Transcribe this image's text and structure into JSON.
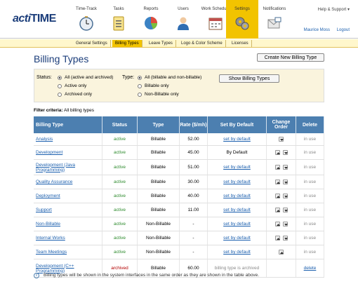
{
  "app": {
    "logo_a": "acti",
    "logo_b": "TIME",
    "help": "Help & Support ▾",
    "user": "Maurice Moss",
    "logout": "Logout"
  },
  "nav": [
    {
      "label": "Time-Track",
      "icon": "clock-icon",
      "active": false
    },
    {
      "label": "Tasks",
      "icon": "clipboard-icon",
      "active": false
    },
    {
      "label": "Reports",
      "icon": "pie-chart-icon",
      "active": false
    },
    {
      "label": "Users",
      "icon": "user-icon",
      "active": false
    },
    {
      "label": "Work Schedule",
      "icon": "calendar-icon",
      "active": false
    },
    {
      "label": "Settings",
      "icon": "gears-icon",
      "active": true
    },
    {
      "label": "Notifications",
      "icon": "notifications-icon",
      "active": false
    }
  ],
  "subnav": [
    {
      "label": "General Settings",
      "active": false
    },
    {
      "label": "Billing Types",
      "active": true
    },
    {
      "label": "Leave Types",
      "active": false
    },
    {
      "label": "Logo & Color Scheme",
      "active": false
    },
    {
      "label": "Licenses",
      "active": false
    }
  ],
  "page": {
    "title": "Billing Types",
    "create_button": "Create New Billing Type"
  },
  "filters": {
    "status_label": "Status:",
    "type_label": "Type:",
    "status_options": [
      "All (active and archived)",
      "Active only",
      "Archived only"
    ],
    "status_selected": 0,
    "type_options": [
      "All (billable and non-billable)",
      "Billable only",
      "Non-Billable only"
    ],
    "type_selected": 0,
    "show_button": "Show Billing Types",
    "criteria_label": "Filter criteria:",
    "criteria_value": "All billing types"
  },
  "table": {
    "headers": [
      "Billing Type",
      "Status",
      "Type",
      "Rate ($/mh)",
      "Set By Default",
      "Change Order",
      "Delete"
    ],
    "rows": [
      {
        "name": "Analysis",
        "status": "active",
        "type": "Billable",
        "rate": "52.00",
        "default": "set by default",
        "default_link": true,
        "order": "down",
        "delete": "in use",
        "delete_link": false
      },
      {
        "name": "Development",
        "status": "active",
        "type": "Billable",
        "rate": "45.00",
        "default": "By Default",
        "default_link": false,
        "order": "both",
        "delete": "in use",
        "delete_link": false
      },
      {
        "name": "Development (Java Programming)",
        "status": "active",
        "type": "Billable",
        "rate": "51.00",
        "default": "set by default",
        "default_link": true,
        "order": "both",
        "delete": "in use",
        "delete_link": false
      },
      {
        "name": "Quality Assurance",
        "status": "active",
        "type": "Billable",
        "rate": "30.00",
        "default": "set by default",
        "default_link": true,
        "order": "both",
        "delete": "in use",
        "delete_link": false
      },
      {
        "name": "Deployment",
        "status": "active",
        "type": "Billable",
        "rate": "40.00",
        "default": "set by default",
        "default_link": true,
        "order": "both",
        "delete": "in use",
        "delete_link": false
      },
      {
        "name": "Support",
        "status": "active",
        "type": "Billable",
        "rate": "11.00",
        "default": "set by default",
        "default_link": true,
        "order": "both",
        "delete": "in use",
        "delete_link": false
      },
      {
        "name": "Non-Billable",
        "status": "active",
        "type": "Non-Billable",
        "rate": "-",
        "default": "set by default",
        "default_link": true,
        "order": "both",
        "delete": "in use",
        "delete_link": false
      },
      {
        "name": "Internal Works",
        "status": "active",
        "type": "Non-Billable",
        "rate": "-",
        "default": "set by default",
        "default_link": true,
        "order": "both",
        "delete": "in use",
        "delete_link": false
      },
      {
        "name": "Team Meetings",
        "status": "active",
        "type": "Non-Billable",
        "rate": "-",
        "default": "set by default",
        "default_link": true,
        "order": "up",
        "delete": "in use",
        "delete_link": false
      },
      {
        "name": "Development (C++ Programming)",
        "status": "archived",
        "type": "Billable",
        "rate": "60.00",
        "default": "billing type is archived",
        "default_link": false,
        "order": "none",
        "delete": "delete",
        "delete_link": true
      }
    ]
  },
  "note": "Billing types will be shown in the system interfaces in the same order as they are shown in the table above."
}
